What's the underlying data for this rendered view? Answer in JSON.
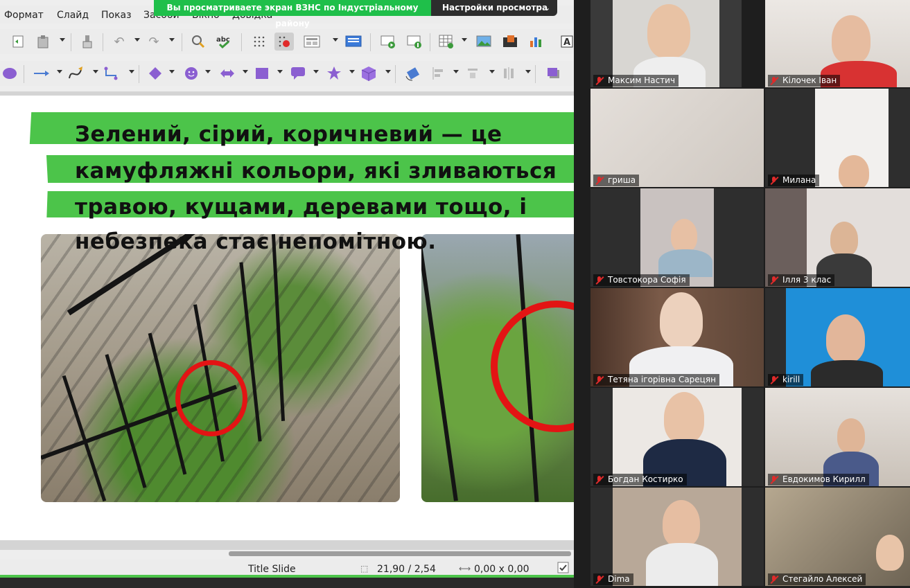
{
  "app": {
    "menu": [
      "Формат",
      "Слайд",
      "Показ",
      "Засоби",
      "Вікно",
      "Довідка"
    ],
    "share_banner": "Вы просматриваете экран ВЗНС по Індустріальному району",
    "view_options": "Настройки просмотра",
    "slide": {
      "lines": [
        "Зелений, сірий, коричневий — це",
        "камуфляжні кольори, які зливаються",
        "травою, кущами, деревами тощо, і",
        "небезпека стає непомітною."
      ],
      "accent_color": "#4cc44a",
      "highlight_color": "#e31414"
    },
    "status": {
      "layout": "Title Slide",
      "position": "21,90 / 2,54",
      "size": "0,00 x 0,00"
    }
  },
  "participants": [
    {
      "name": "Максим Настич"
    },
    {
      "name": "Кілочек Іван"
    },
    {
      "name": "гриша"
    },
    {
      "name": "Милана"
    },
    {
      "name": "Товстокора Софія"
    },
    {
      "name": "Ілля 3 клас"
    },
    {
      "name": "Тетяна ігорівна Сарецян"
    },
    {
      "name": "kirill"
    },
    {
      "name": "Богдан Костирко"
    },
    {
      "name": "Евдокимов Кирилл"
    },
    {
      "name": "Dima"
    },
    {
      "name": "Стегайло Алексей"
    }
  ]
}
